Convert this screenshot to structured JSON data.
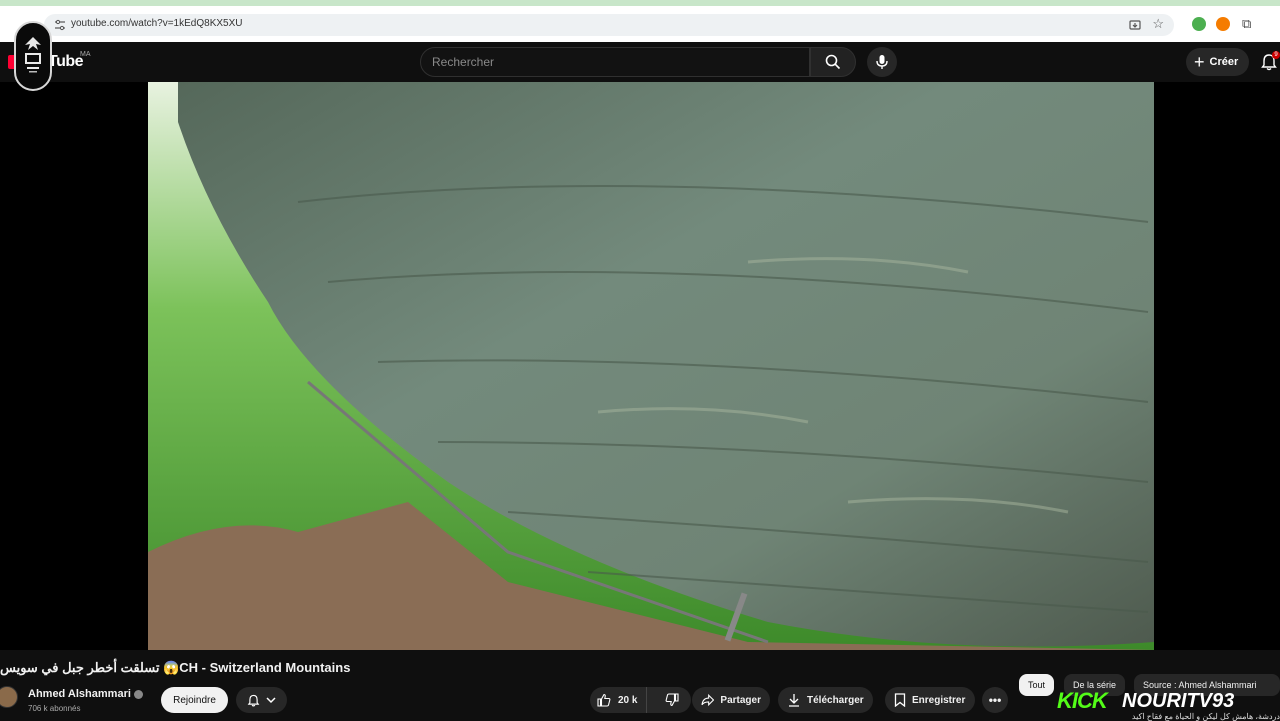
{
  "browser": {
    "url": "youtube.com/watch?v=1kEdQ8KX5XU"
  },
  "header": {
    "wordmark": "Tube",
    "country_code": "MA",
    "create_label": "Créer",
    "notification_count": "9"
  },
  "search": {
    "placeholder": "Rechercher"
  },
  "video": {
    "title": "تسلقت أخطر جبل في سويس 😱CH - Switzerland Mountains",
    "channel_name": "Ahmed Alshammari",
    "subscribers": "706 k abonnés",
    "join_label": "Rejoindre",
    "like_count": "20 k",
    "share_label": "Partager",
    "download_label": "Télécharger",
    "save_label": "Enregistrer"
  },
  "chips": {
    "all": "Tout",
    "series": "De la série",
    "source": "Source : Ahmed Alshammari"
  },
  "overlay": {
    "kick": "KICK",
    "handle": "NOURITV93",
    "ticker": "دردشة، هامش كل ليكن و الحياة مع فقاح اكيد"
  },
  "colors": {
    "brand_red": "#ff0033",
    "kick_green": "#53fc18",
    "background": "#0f0f0f"
  }
}
